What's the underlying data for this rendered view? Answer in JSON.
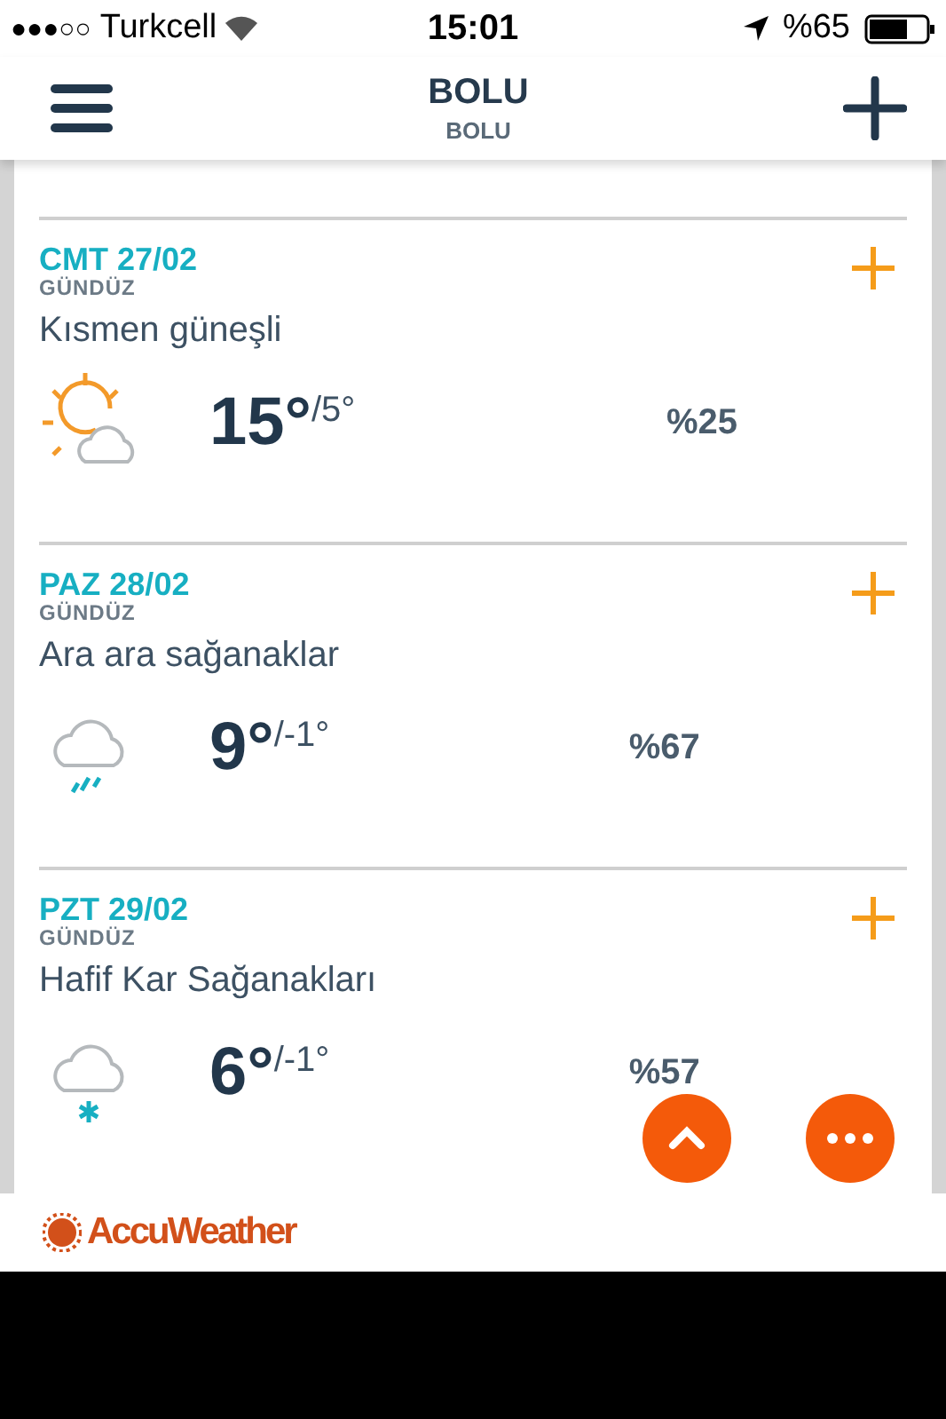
{
  "status_bar": {
    "carrier": "Turkcell",
    "signal_dots": "●●●○○",
    "time": "15:01",
    "battery": "%65"
  },
  "header": {
    "title": "BOLU",
    "subtitle": "BOLU"
  },
  "days": [
    {
      "date": "CMT 27/02",
      "period": "GÜNDÜZ",
      "condition": "Kısmen güneşli",
      "kind": "partly-sunny",
      "high": "15°",
      "low": "/5°",
      "precip": "%25"
    },
    {
      "date": "PAZ 28/02",
      "period": "GÜNDÜZ",
      "condition": "Ara ara sağanaklar",
      "kind": "rain",
      "high": "9°",
      "low": "/-1°",
      "precip": "%67"
    },
    {
      "date": "PZT 29/02",
      "period": "GÜNDÜZ",
      "condition": "Hafif Kar Sağanakları",
      "kind": "snow",
      "high": "6°",
      "low": "/-1°",
      "precip": "%57"
    }
  ],
  "footer": {
    "brand": "AccuWeather"
  }
}
